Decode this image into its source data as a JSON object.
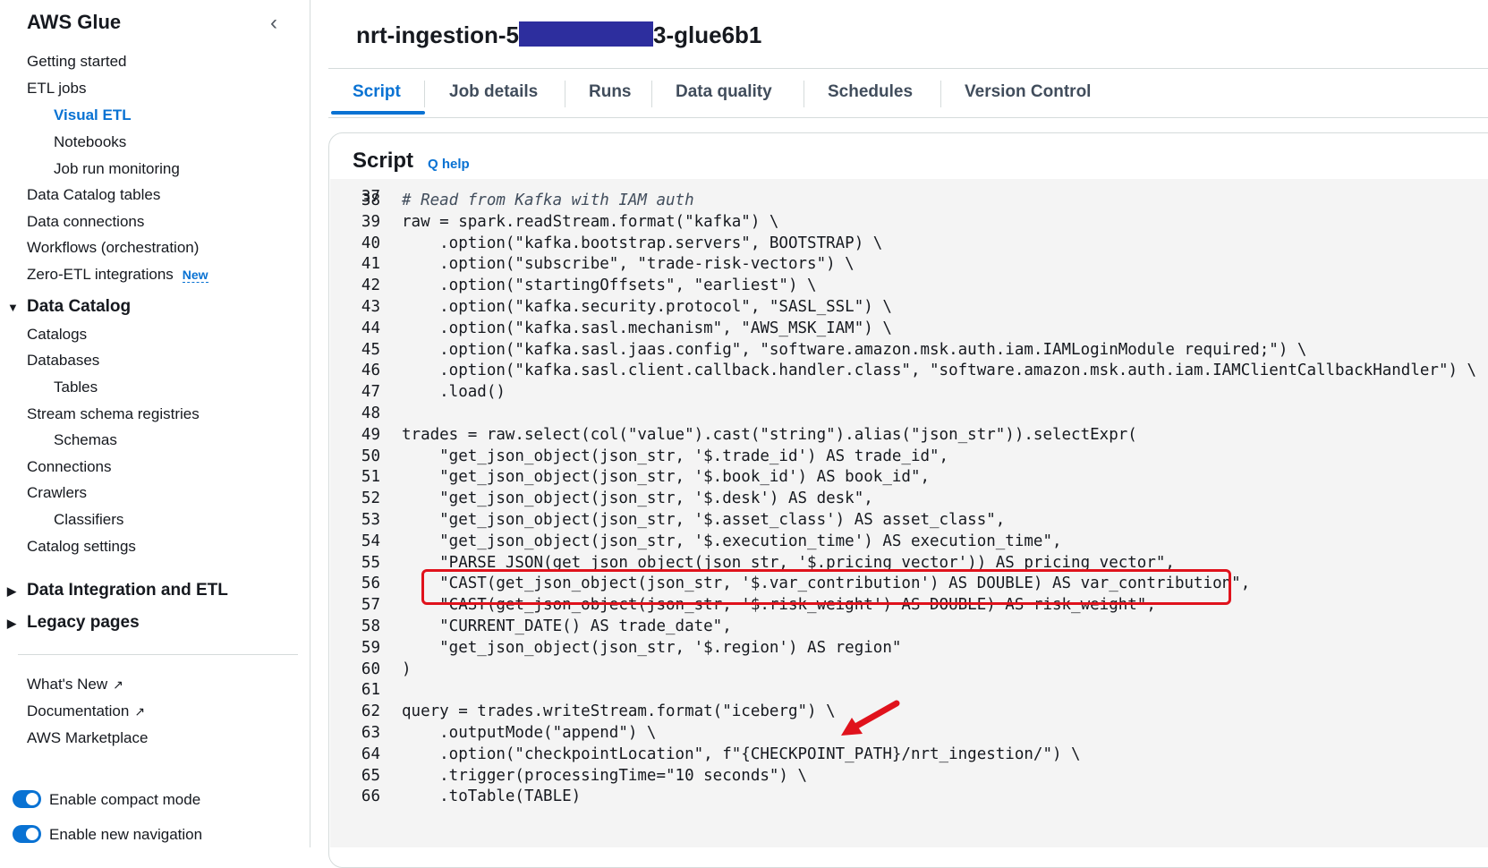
{
  "sidebar": {
    "title": "AWS Glue",
    "collapse_icon": "chevron-left-icon",
    "items": [
      {
        "label": "Getting started"
      },
      {
        "label": "ETL jobs"
      },
      {
        "label": "Visual ETL"
      },
      {
        "label": "Notebooks"
      },
      {
        "label": "Job run monitoring"
      },
      {
        "label": "Data Catalog tables"
      },
      {
        "label": "Data connections"
      },
      {
        "label": "Workflows (orchestration)"
      },
      {
        "label": "Zero-ETL integrations",
        "badge": "New"
      }
    ],
    "data_catalog": {
      "label": "Data Catalog",
      "items": [
        "Catalogs",
        "Databases",
        "Tables",
        "Stream schema registries",
        "Schemas",
        "Connections",
        "Crawlers",
        "Classifiers",
        "Catalog settings"
      ]
    },
    "sections": [
      "Data Integration and ETL",
      "Legacy pages"
    ],
    "footer_links": [
      "What's New",
      "Documentation",
      "AWS Marketplace"
    ],
    "toggles": [
      {
        "label": "Enable compact mode",
        "on": true
      },
      {
        "label": "Enable new navigation",
        "on": true
      }
    ],
    "accent_color": "#0972d3"
  },
  "header": {
    "title_prefix": "nrt-ingestion-5",
    "title_suffix": "3-glue6b1"
  },
  "tabs": [
    "Script",
    "Job details",
    "Runs",
    "Data quality",
    "Schedules",
    "Version Control"
  ],
  "active_tab": "Script",
  "script": {
    "title": "Script",
    "help_label": "Q help",
    "partial_top_line": "37",
    "lines": [
      {
        "n": "38",
        "code": "# Read from Kafka with IAM auth",
        "comment": true
      },
      {
        "n": "39",
        "code": "raw = spark.readStream.format(\"kafka\") \\"
      },
      {
        "n": "40",
        "code": "    .option(\"kafka.bootstrap.servers\", BOOTSTRAP) \\"
      },
      {
        "n": "41",
        "code": "    .option(\"subscribe\", \"trade-risk-vectors\") \\"
      },
      {
        "n": "42",
        "code": "    .option(\"startingOffsets\", \"earliest\") \\"
      },
      {
        "n": "43",
        "code": "    .option(\"kafka.security.protocol\", \"SASL_SSL\") \\"
      },
      {
        "n": "44",
        "code": "    .option(\"kafka.sasl.mechanism\", \"AWS_MSK_IAM\") \\"
      },
      {
        "n": "45",
        "code": "    .option(\"kafka.sasl.jaas.config\", \"software.amazon.msk.auth.iam.IAMLoginModule required;\") \\"
      },
      {
        "n": "46",
        "code": "    .option(\"kafka.sasl.client.callback.handler.class\", \"software.amazon.msk.auth.iam.IAMClientCallbackHandler\") \\"
      },
      {
        "n": "47",
        "code": "    .load()"
      },
      {
        "n": "48",
        "code": ""
      },
      {
        "n": "49",
        "code": "trades = raw.select(col(\"value\").cast(\"string\").alias(\"json_str\")).selectExpr("
      },
      {
        "n": "50",
        "code": "    \"get_json_object(json_str, '$.trade_id') AS trade_id\","
      },
      {
        "n": "51",
        "code": "    \"get_json_object(json_str, '$.book_id') AS book_id\","
      },
      {
        "n": "52",
        "code": "    \"get_json_object(json_str, '$.desk') AS desk\","
      },
      {
        "n": "53",
        "code": "    \"get_json_object(json_str, '$.asset_class') AS asset_class\","
      },
      {
        "n": "54",
        "code": "    \"get_json_object(json_str, '$.execution_time') AS execution_time\","
      },
      {
        "n": "55",
        "code": "    \"PARSE_JSON(get_json_object(json_str, '$.pricing_vector')) AS pricing_vector\","
      },
      {
        "n": "56",
        "code": "    \"CAST(get_json_object(json_str, '$.var_contribution') AS DOUBLE) AS var_contribution\","
      },
      {
        "n": "57",
        "code": "    \"CAST(get_json_object(json_str, '$.risk_weight') AS DOUBLE) AS risk_weight\","
      },
      {
        "n": "58",
        "code": "    \"CURRENT_DATE() AS trade_date\","
      },
      {
        "n": "59",
        "code": "    \"get_json_object(json_str, '$.region') AS region\""
      },
      {
        "n": "60",
        "code": ")"
      },
      {
        "n": "61",
        "code": ""
      },
      {
        "n": "62",
        "code": "query = trades.writeStream.format(\"iceberg\") \\"
      },
      {
        "n": "63",
        "code": "    .outputMode(\"append\") \\"
      },
      {
        "n": "64",
        "code": "    .option(\"checkpointLocation\", f\"{CHECKPOINT_PATH}/nrt_ingestion/\") \\"
      },
      {
        "n": "65",
        "code": "    .trigger(processingTime=\"10 seconds\") \\"
      },
      {
        "n": "66",
        "code": "    .toTable(TABLE)"
      }
    ],
    "annotation_color": "#e0121c"
  }
}
